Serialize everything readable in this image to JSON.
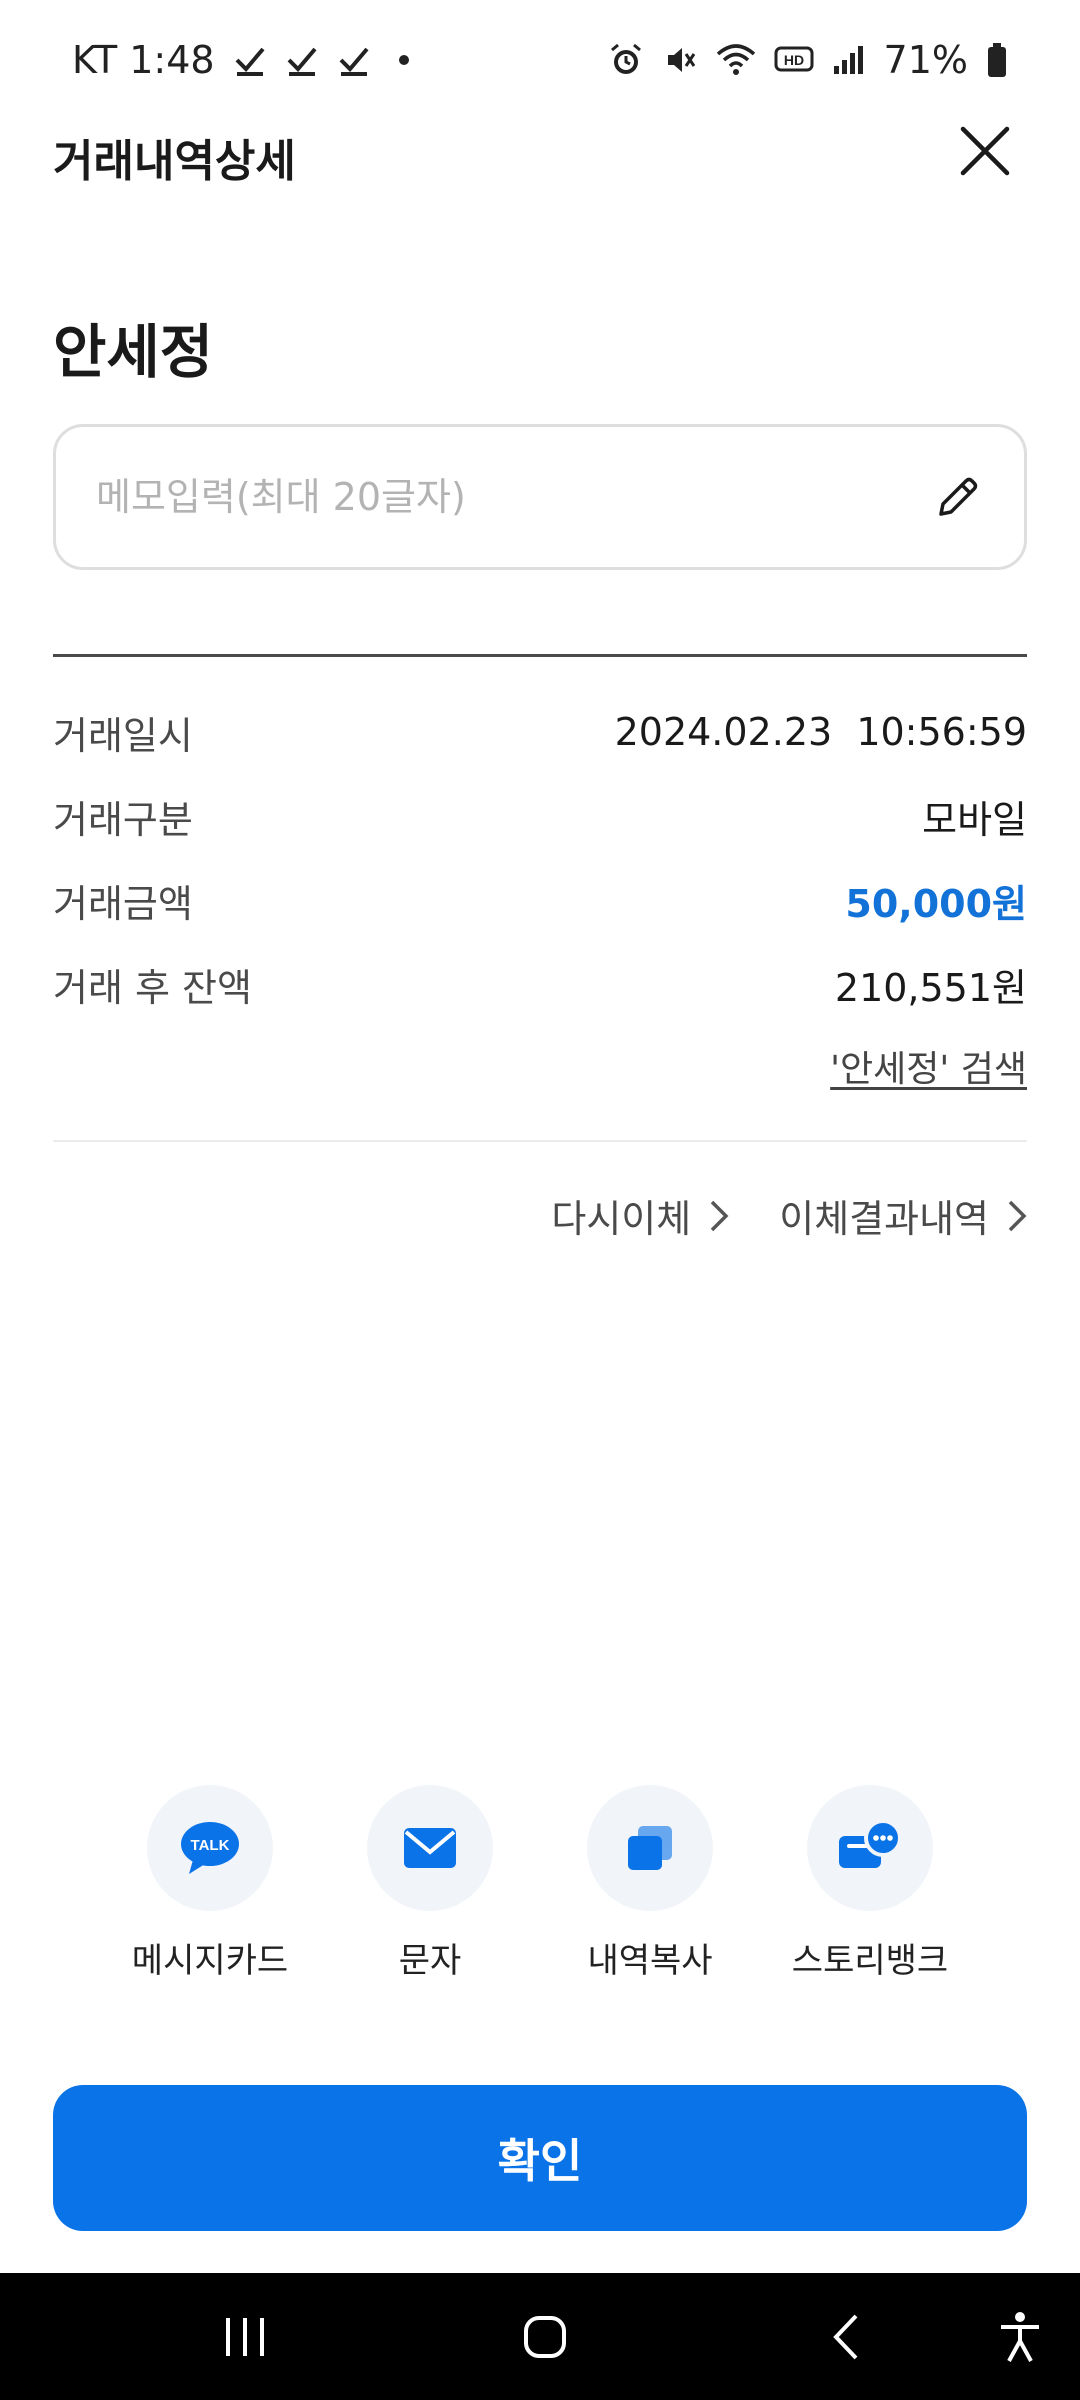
{
  "status": {
    "carrier_time": "KT 1:48",
    "battery": "71%"
  },
  "header": {
    "title": "거래내역상세"
  },
  "recipient": {
    "name": "안세정"
  },
  "memo": {
    "placeholder": "메모입력(최대 20글자)",
    "value": ""
  },
  "details": [
    {
      "label": "거래일시",
      "value": "2024.02.23  10:56:59"
    },
    {
      "label": "거래구분",
      "value": "모바일"
    },
    {
      "label": "거래금액",
      "value": "50,000원"
    },
    {
      "label": "거래 후 잔액",
      "value": "210,551원"
    }
  ],
  "search_link": "'안세정' 검색",
  "actions": {
    "retransfer": "다시이체",
    "history": "이체결과내역"
  },
  "share": [
    {
      "label": "메시지카드",
      "icon": "kakaotalk-icon"
    },
    {
      "label": "문자",
      "icon": "mail-icon"
    },
    {
      "label": "내역복사",
      "icon": "copy-icon"
    },
    {
      "label": "스토리뱅크",
      "icon": "chat-bubbles-icon"
    }
  ],
  "kakao_badge": "TALK",
  "confirm_label": "확인",
  "colors": {
    "primary": "#0a73e8",
    "amount": "#1272d8"
  }
}
